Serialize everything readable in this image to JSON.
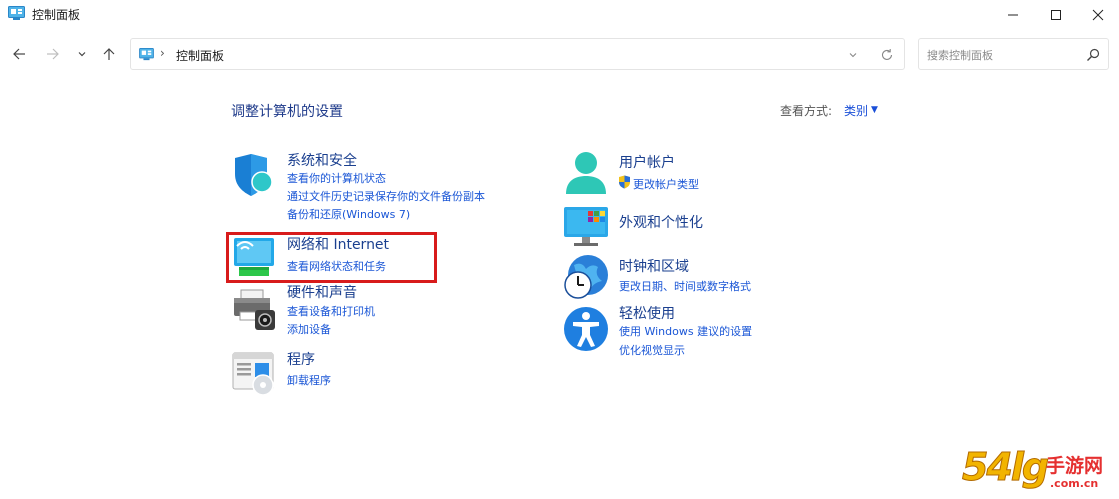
{
  "window": {
    "title": "控制面板"
  },
  "address": {
    "crumb": "控制面板",
    "separator": "›"
  },
  "search": {
    "placeholder": "搜索控制面板"
  },
  "main": {
    "title": "调整计算机的设置",
    "view_label": "查看方式:",
    "view_value": "类别",
    "view_caret": "▼"
  },
  "categories": {
    "system": {
      "title": "系统和安全",
      "links": [
        "查看你的计算机状态",
        "通过文件历史记录保存你的文件备份副本",
        "备份和还原(Windows 7)"
      ]
    },
    "network": {
      "title": "网络和 Internet",
      "links": [
        "查看网络状态和任务"
      ]
    },
    "hardware": {
      "title": "硬件和声音",
      "links": [
        "查看设备和打印机",
        "添加设备"
      ]
    },
    "programs": {
      "title": "程序",
      "links": [
        "卸载程序"
      ]
    },
    "user": {
      "title": "用户帐户",
      "links": [
        "更改帐户类型"
      ]
    },
    "appearance": {
      "title": "外观和个性化",
      "links": []
    },
    "clock": {
      "title": "时钟和区域",
      "links": [
        "更改日期、时间或数字格式"
      ]
    },
    "ease": {
      "title": "轻松使用",
      "links": [
        "使用 Windows 建议的设置",
        "优化视觉显示"
      ]
    }
  },
  "watermark": {
    "text": "54lg",
    "text2": "手游网",
    "domain": ".com.cn"
  },
  "colors": {
    "accent": "#1a56d6",
    "heading": "#1a3f8f",
    "highlight": "#d81b1b"
  }
}
